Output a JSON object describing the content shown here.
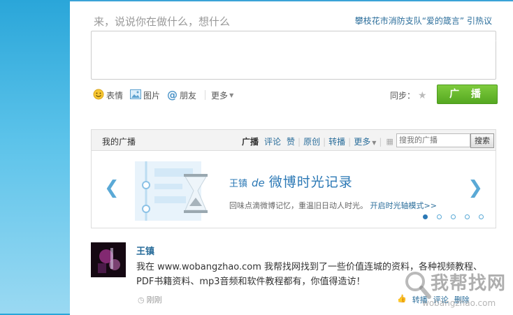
{
  "composer": {
    "prompt": "来，说说你在做什么，想什么",
    "hot_topic_prefix": "攀枝花市消防支队",
    "hot_topic_quote": "“爱的箴言”",
    "hot_topic_suffix": "引热议",
    "tools": [
      {
        "label": "表情",
        "icon": "smile-icon"
      },
      {
        "label": "图片",
        "icon": "image-icon"
      },
      {
        "label": "朋友",
        "icon": "at-icon"
      }
    ],
    "more": "更多",
    "sync_label": "同步：",
    "broadcast_button": "广 播"
  },
  "feed_bar": {
    "title": "我的广播",
    "filters": [
      "广播",
      "评论",
      "赞",
      "原创",
      "转播",
      "更多"
    ],
    "search_placeholder": "搜我的广播",
    "search_button": "搜索"
  },
  "banner": {
    "name": "王镇",
    "de": "de",
    "title": "微博时光记录",
    "subtitle": "回味点滴微博记忆，重温旧日动人时光。",
    "link": "开启时光轴模式>>",
    "dots_total": 5,
    "dots_active_index": 0
  },
  "post": {
    "author": "王镇",
    "text": "我在 www.wobangzhao.com 我帮找网找到了一些价值连城的资料，各种视频教程、PDF书籍资料、mp3音频和软件教程都有，你值得造访！",
    "time": "刚刚",
    "actions": [
      "转播",
      "评论",
      "删除"
    ]
  },
  "watermark": {
    "main": "我帮找网",
    "sub": "wobangzhao.com"
  },
  "colors": {
    "accent_blue": "#2b6e9b",
    "broadcast_green": "#66b82e",
    "background_blue": "#5cc3ea"
  }
}
